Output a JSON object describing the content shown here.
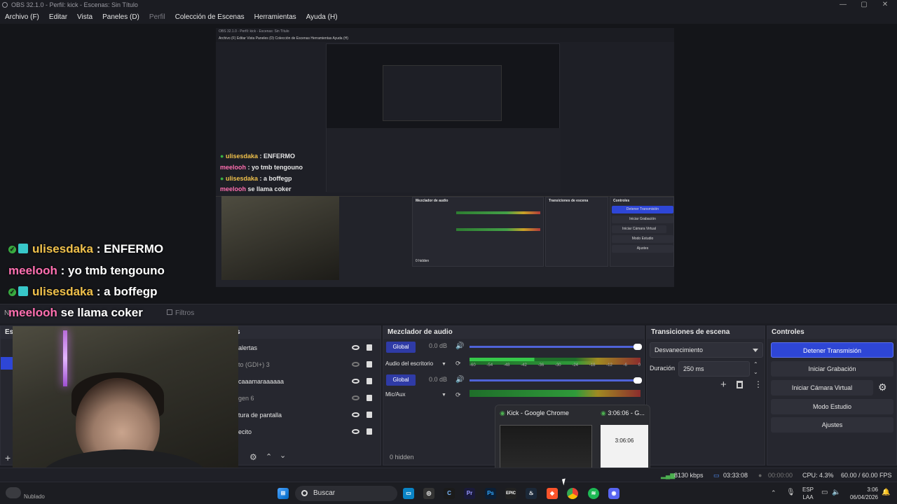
{
  "window": {
    "title": "OBS 32.1.0 - Perfil: kick - Escenas: Sin Título",
    "controls": [
      "—",
      "▢",
      "✕"
    ]
  },
  "menu": [
    "Archivo (F)",
    "Editar",
    "Vista",
    "Paneles (D)",
    "Perfil",
    "Colección de Escenas",
    "Herramientas",
    "Ayuda (H)"
  ],
  "chat": [
    {
      "user": "ulisesdaka",
      "text": ": ENFERMO",
      "verified": true
    },
    {
      "user": "meelooh",
      "text": ": yo tmb tengouno",
      "verified": false
    },
    {
      "user": "ulisesdaka",
      "text": ": a boffegp",
      "verified": true
    },
    {
      "user": "meelooh",
      "text": "se llama coker",
      "verified": false
    }
  ],
  "toolbar": {
    "filters": "Filtros",
    "source_prefix": "N"
  },
  "docks": {
    "scenes": "Esc",
    "sources": "s",
    "mixer": "Mezclador de audio",
    "transitions": "Transiciones de escena",
    "controls": "Controles"
  },
  "sources": [
    {
      "name": "alertas",
      "visible": true
    },
    {
      "name": "to (GDI+) 3",
      "visible": false
    },
    {
      "name": "caaamaraaaaaa",
      "visible": true
    },
    {
      "name": "gen 6",
      "visible": false
    },
    {
      "name": "tura de pantalla",
      "visible": true
    },
    {
      "name": "ecito",
      "visible": true
    }
  ],
  "mixer": {
    "channels": [
      {
        "badge": "Global",
        "db": "0.0 dB",
        "name": "Audio del escritorio"
      },
      {
        "badge": "Global",
        "db": "0.0 dB",
        "name": "Mic/Aux"
      }
    ],
    "ticks": [
      "-60",
      "-54",
      "-48",
      "-42",
      "-36",
      "-30",
      "-24",
      "-18",
      "-12",
      "-6",
      "0"
    ],
    "hidden": "0 hidden"
  },
  "transitions": {
    "selected": "Desvanecimiento",
    "duration_label": "Duración",
    "duration_value": "250 ms"
  },
  "controls": {
    "stop_stream": "Detener Transmisión",
    "start_record": "Iniciar Grabación",
    "virtual_cam": "Iniciar Cámara Virtual",
    "studio_mode": "Modo Estudio",
    "settings": "Ajustes"
  },
  "taskbar_preview": {
    "item1": "Kick - Google Chrome",
    "item2": "3:06:06 - G...",
    "clock_thumb": "3:06:06"
  },
  "status": {
    "bitrate": "8130 kbps",
    "stream_time": "03:33:08",
    "rec_time": "00:00:00",
    "cpu": "CPU: 4.3%",
    "fps": "60.00 / 60.00 FPS"
  },
  "taskbar": {
    "search": "Buscar",
    "weather": "Nublado",
    "lang1": "ESP",
    "lang2": "LAA",
    "time": "3:06",
    "date": "06/04/2026"
  },
  "nested": {
    "title": "OBS 32.1.0 - Perfil: kick - Escenas: Sin Título",
    "menu": "Archivo (F)   Editar   Vista   Paneles (D)   Colección de Escenas   Herramientas   Ayuda (H)",
    "stop": "Detener Transmisión",
    "rec": "Iniciar Grabación",
    "vcam": "Iniciar Cámara Virtual",
    "studio": "Modo Estudio",
    "settings": "Ajustes",
    "mixer": "Mezclador de audio",
    "trans": "Transiciones de escena",
    "controls": "Controles",
    "hidden": "0 hidden"
  },
  "colors": {
    "accent": "#2e46d6",
    "verified": "#3bb143",
    "user1": "#f0c14b",
    "user2": "#ff6fb0"
  }
}
